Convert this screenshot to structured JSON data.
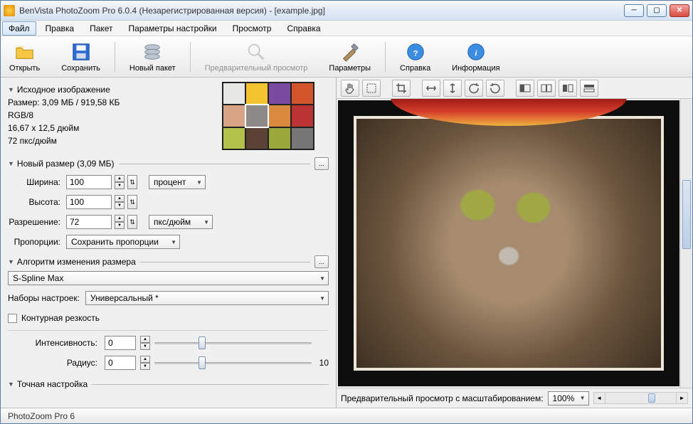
{
  "title": "BenVista PhotoZoom Pro 6.0.4 (Незарегистрированная версия) - [example.jpg]",
  "menu": {
    "file": "Файл",
    "edit": "Правка",
    "batch": "Пакет",
    "prefs": "Параметры настройки",
    "view": "Просмотр",
    "help": "Справка"
  },
  "tb": {
    "open": "Открыть",
    "save": "Сохранить",
    "newbatch": "Новый пакет",
    "preview": "Предварительный просмотр",
    "params": "Параметры",
    "helpref": "Справка",
    "info": "Информация"
  },
  "src": {
    "header": "Исходное изображение",
    "size": "Размер: 3,09 МБ / 919,58 КБ",
    "mode": "RGB/8",
    "dim": "16,67 x 12,5 дюйм",
    "dpi": "72 пкс/дюйм"
  },
  "newsize": {
    "header": "Новый размер (3,09 МБ)",
    "width_l": "Ширина:",
    "width_v": "100",
    "height_l": "Высота:",
    "height_v": "100",
    "unit": "процент",
    "res_l": "Разрешение:",
    "res_v": "72",
    "res_unit": "пкс/дюйм",
    "prop_l": "Пропорции:",
    "prop_v": "Сохранить пропорции"
  },
  "algo": {
    "header": "Алгоритм изменения размера",
    "method": "S-Spline Max",
    "preset_l": "Наборы настроек:",
    "preset_v": "Универсальный *"
  },
  "sharp": {
    "chk": "Контурная резкость",
    "int_l": "Интенсивность:",
    "int_v": "0",
    "int_max": "",
    "rad_l": "Радиус:",
    "rad_v": "0",
    "rad_max": "10"
  },
  "fine": {
    "header": "Точная настройка"
  },
  "preview_footer": {
    "label": "Предварительный просмотр с масштабированием:",
    "zoom": "100%"
  },
  "status": "PhotoZoom Pro 6",
  "ellipsis": "..."
}
